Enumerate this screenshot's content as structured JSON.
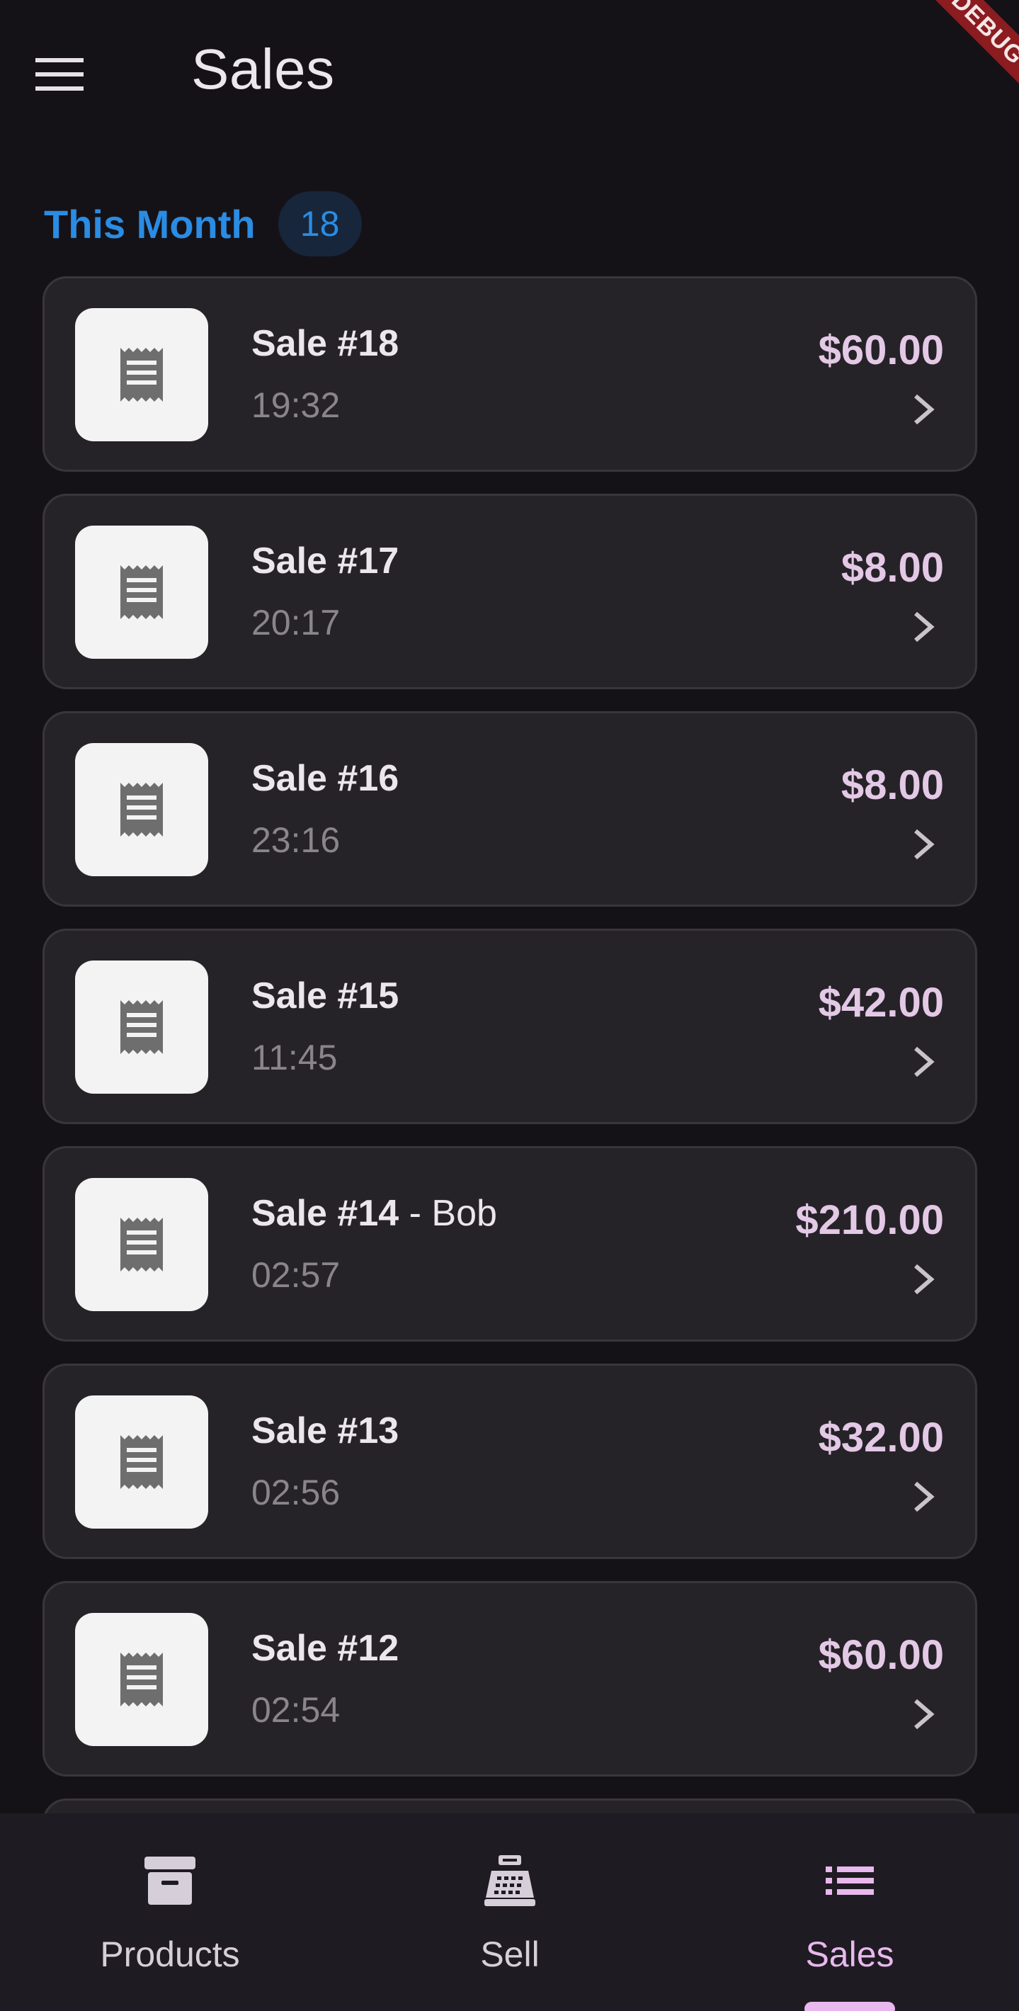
{
  "app_bar": {
    "title": "Sales",
    "menu_icon": "menu-icon"
  },
  "debug_banner": {
    "text": "DEBUG"
  },
  "section": {
    "title": "This Month",
    "count": "18"
  },
  "sales": [
    {
      "title": "Sale #18",
      "customer": "",
      "time": "19:32",
      "total": "$60.00"
    },
    {
      "title": "Sale #17",
      "customer": "",
      "time": "20:17",
      "total": "$8.00"
    },
    {
      "title": "Sale #16",
      "customer": "",
      "time": "23:16",
      "total": "$8.00"
    },
    {
      "title": "Sale #15",
      "customer": "",
      "time": "11:45",
      "total": "$42.00"
    },
    {
      "title": "Sale #14",
      "customer": " - Bob",
      "time": "02:57",
      "total": "$210.00"
    },
    {
      "title": "Sale #13",
      "customer": "",
      "time": "02:56",
      "total": "$32.00"
    },
    {
      "title": "Sale #12",
      "customer": "",
      "time": "02:54",
      "total": "$60.00"
    }
  ],
  "bottom_nav": {
    "items": [
      {
        "label": "Products",
        "icon": "archive-box-icon",
        "active": false
      },
      {
        "label": "Sell",
        "icon": "cash-register-icon",
        "active": false
      },
      {
        "label": "Sales",
        "icon": "list-icon",
        "active": true
      }
    ]
  },
  "colors": {
    "background": "#151217",
    "card": "#262328",
    "accent_blue": "#2a8ce3",
    "accent_pink": "#e8b8ee",
    "price": "#e3c9e6",
    "debug_red": "#8b1c1f"
  }
}
